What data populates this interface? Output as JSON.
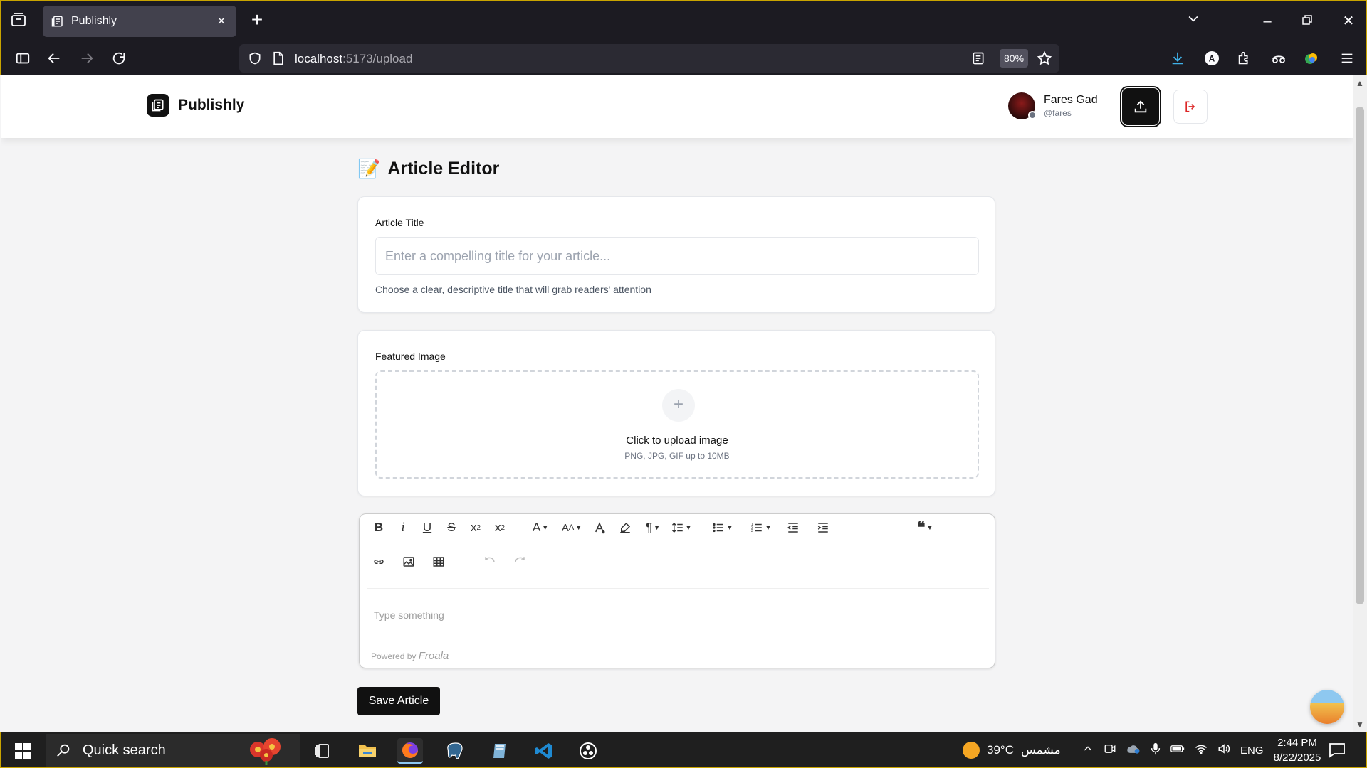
{
  "browser": {
    "tab_title": "Publishly",
    "url_host": "localhost",
    "url_path": ":5173/upload",
    "zoom": "80%"
  },
  "header": {
    "brand": "Publishly",
    "user_name": "Fares Gad",
    "user_handle": "@fares"
  },
  "page": {
    "heading": "Article Editor",
    "heading_emoji": "📝",
    "title_field": {
      "label": "Article Title",
      "placeholder": "Enter a compelling title for your article...",
      "value": "",
      "hint": "Choose a clear, descriptive title that will grab readers' attention"
    },
    "image_field": {
      "label": "Featured Image",
      "upload_text": "Click to upload image",
      "upload_hint": "PNG, JPG, GIF up to 10MB"
    },
    "editor": {
      "placeholder": "Type something",
      "powered_by": "Powered by",
      "powered_brand": "Froala"
    },
    "save_label": "Save Article"
  },
  "taskbar": {
    "search_label": "Quick search",
    "weather_temp": "39°C",
    "weather_text": "مشمس",
    "language": "ENG",
    "time": "2:44 PM",
    "date": "8/22/2025"
  },
  "colors": {
    "accent": "#111111",
    "logout": "#dc2626",
    "chrome_bg": "#1c1b22"
  }
}
